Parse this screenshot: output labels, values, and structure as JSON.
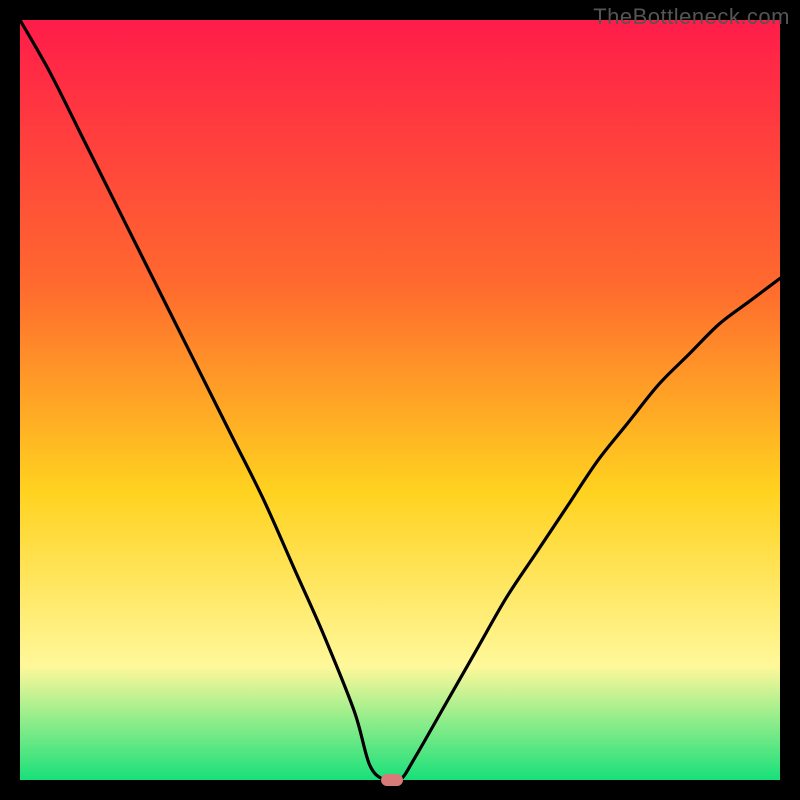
{
  "watermark": {
    "text": "TheBottleneck.com"
  },
  "colors": {
    "gradient_top": "#ff1c4a",
    "gradient_mid1": "#ff6a2e",
    "gradient_mid2": "#ffd21f",
    "gradient_mid3": "#fff89a",
    "gradient_bottom": "#18e07a",
    "curve": "#000000",
    "marker": "#d87a77",
    "frame": "#000000"
  },
  "chart_data": {
    "type": "line",
    "title": "",
    "xlabel": "",
    "ylabel": "",
    "xlim": [
      0,
      100
    ],
    "ylim": [
      0,
      100
    ],
    "grid": false,
    "legend": false,
    "curve_shape": "V-shaped bottleneck curve: steep descent from the left, flat zero near x≈47–50, rising concave curve to the right",
    "x": [
      0,
      4,
      8,
      12,
      16,
      20,
      24,
      28,
      32,
      36,
      40,
      44,
      46,
      48,
      50,
      52,
      56,
      60,
      64,
      68,
      72,
      76,
      80,
      84,
      88,
      92,
      96,
      100
    ],
    "y": [
      100,
      93,
      85,
      77,
      69,
      61,
      53,
      45,
      37,
      28,
      19,
      9,
      2,
      0,
      0,
      3,
      10,
      17,
      24,
      30,
      36,
      42,
      47,
      52,
      56,
      60,
      63,
      66
    ],
    "optimum_marker": {
      "x": 49,
      "y": 0
    },
    "note": "x and y are both in percent of plot extent; y=0 is bottom (green band), y=100 is top (red band). Values are read off visually; no axis ticks are rendered in the image."
  }
}
